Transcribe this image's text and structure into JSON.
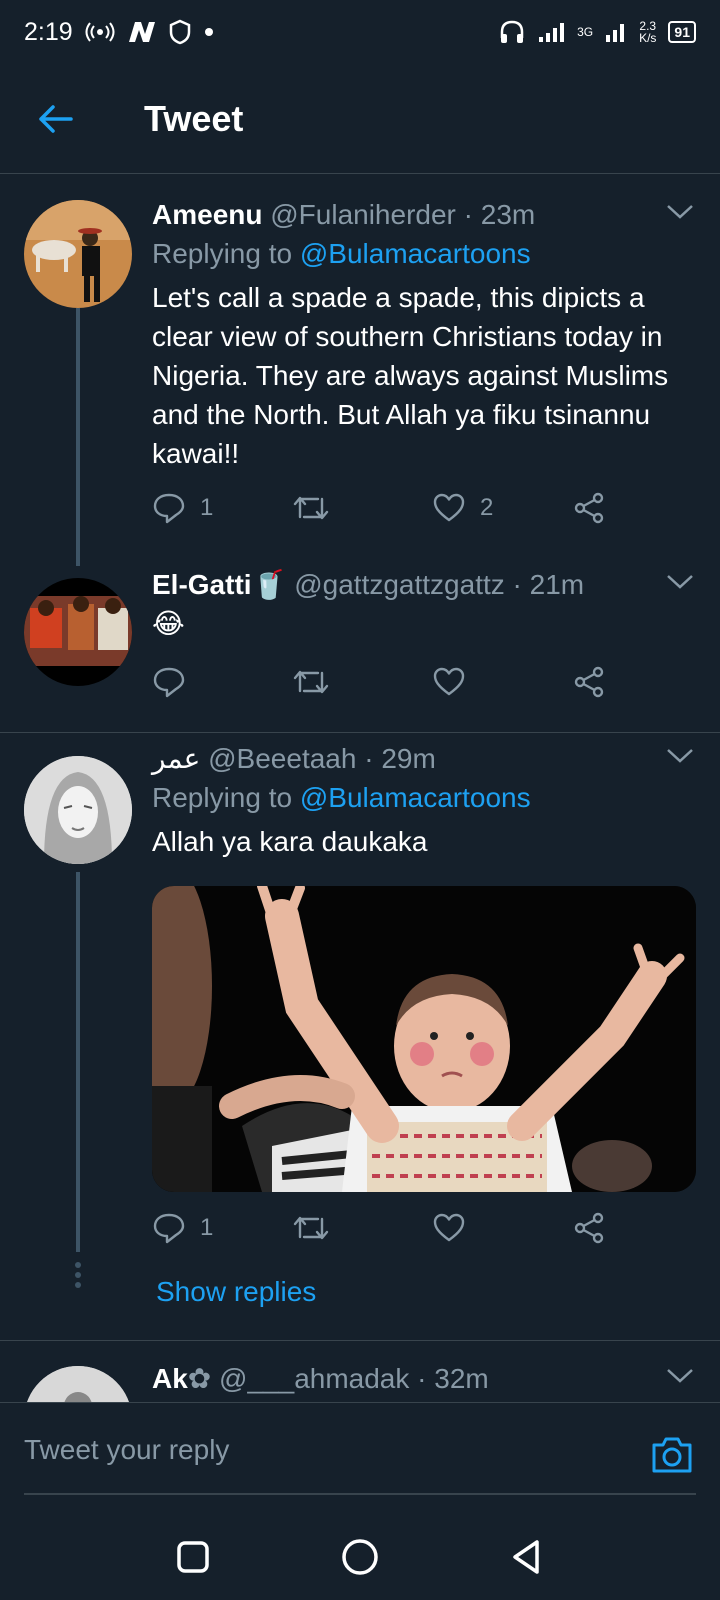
{
  "status_bar": {
    "time": "2:19",
    "network_type": "3G",
    "speed_value": "2.3",
    "speed_unit": "K/s",
    "battery": "91"
  },
  "header": {
    "title": "Tweet"
  },
  "tweets": [
    {
      "name": "Ameenu",
      "handle": "@Fulaniherder",
      "time": "· 23m",
      "replying_label": "Replying to",
      "replying_to": "@Bulamacartoons",
      "text": "Let's call a spade a spade, this dipicts a clear view of southern Christians today in Nigeria. They are always against Muslims and the North. But Allah ya fiku tsinannu kawai!!",
      "reply_count": "1",
      "retweet_count": "",
      "like_count": "2"
    },
    {
      "name": "El-Gatti",
      "name_emoji": "🥤",
      "handle": "@gattzgattzgattz",
      "time": "· 21m",
      "text": "😂",
      "reply_count": "",
      "retweet_count": "",
      "like_count": ""
    },
    {
      "name": "عمر",
      "handle": "@Beeetaah",
      "time": "· 29m",
      "replying_label": "Replying to",
      "replying_to": "@Bulamacartoons",
      "text": "Allah ya kara daukaka",
      "reply_count": "1",
      "retweet_count": "",
      "like_count": "",
      "show_replies": "Show replies"
    },
    {
      "name": "Ak",
      "name_emoji": "✿",
      "handle": "@___ahmadak",
      "time": "· 32m"
    }
  ],
  "reply_bar": {
    "placeholder": "Tweet your reply"
  },
  "colors": {
    "background": "#15202b",
    "accent": "#1da1f2",
    "muted": "#8899a6",
    "divider": "#38444d"
  },
  "icons": [
    "back-arrow-icon",
    "caret-down-icon",
    "reply-icon",
    "retweet-icon",
    "like-icon",
    "share-icon",
    "camera-icon",
    "nav-square-icon",
    "nav-circle-icon",
    "nav-back-icon"
  ]
}
